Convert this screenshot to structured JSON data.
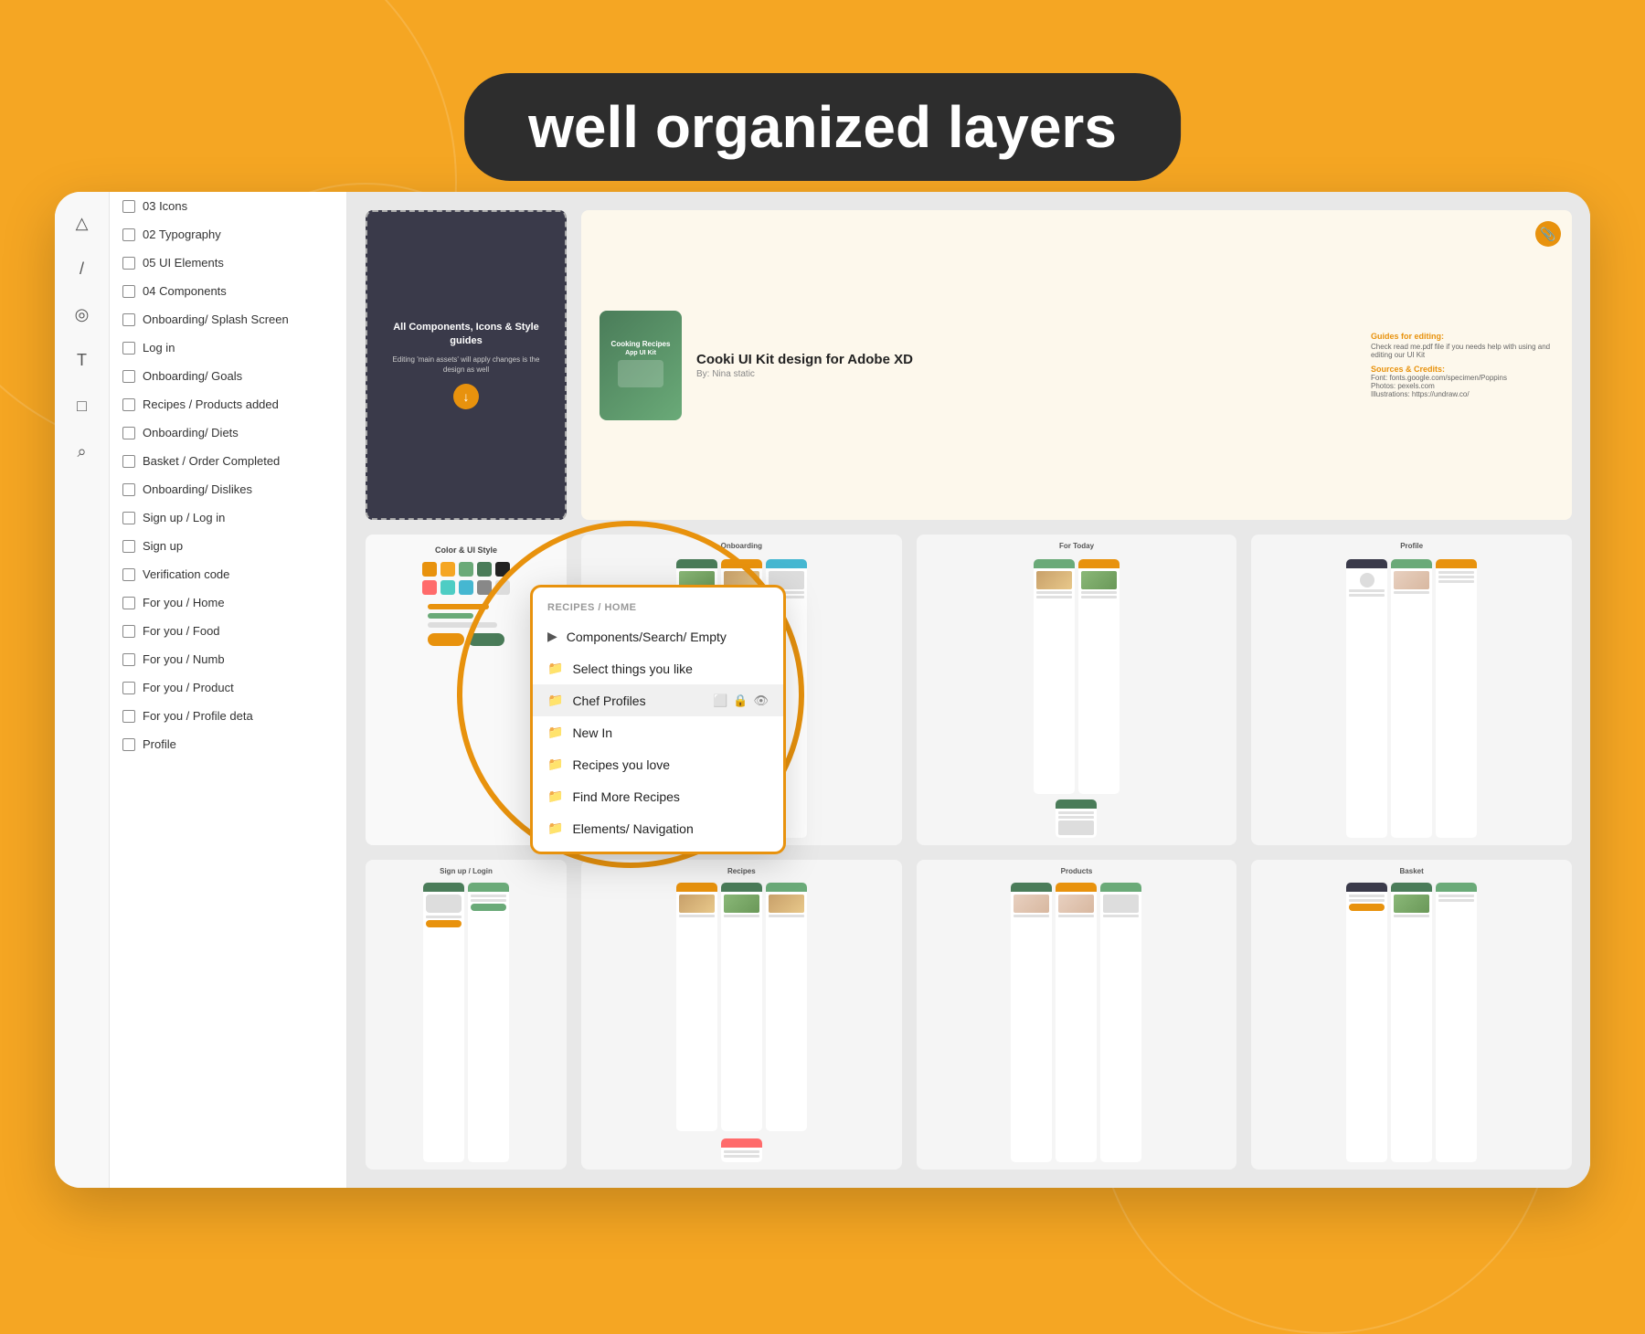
{
  "page": {
    "title": "well organized layers",
    "background_color": "#F5A623"
  },
  "header": {
    "badge_text": "well organized layers"
  },
  "toolbar": {
    "icons": [
      "△",
      "/",
      "◎",
      "T",
      "□",
      "⌕"
    ]
  },
  "layers_panel": {
    "items": [
      {
        "type": "layer",
        "label": "03 Icons"
      },
      {
        "type": "layer",
        "label": "02 Typography"
      },
      {
        "type": "layer",
        "label": "05 UI Elements"
      },
      {
        "type": "layer",
        "label": "04 Components"
      },
      {
        "type": "layer",
        "label": "Onboarding/ Splash Screen"
      },
      {
        "type": "layer",
        "label": "Log in"
      },
      {
        "type": "layer",
        "label": "Onboarding/ Goals"
      },
      {
        "type": "layer",
        "label": "Recipes / Products added"
      },
      {
        "type": "layer",
        "label": "Onboarding/ Diets"
      },
      {
        "type": "layer",
        "label": "Basket / Order Completed"
      },
      {
        "type": "layer",
        "label": "Onboarding/  Dislikes"
      },
      {
        "type": "layer",
        "label": "Sign up / Log in"
      },
      {
        "type": "layer",
        "label": "Sign up"
      },
      {
        "type": "layer",
        "label": "Verification code"
      },
      {
        "type": "layer",
        "label": "For you / Home"
      },
      {
        "type": "layer",
        "label": "For you / Food"
      },
      {
        "type": "layer",
        "label": "For you / Numb"
      },
      {
        "type": "layer",
        "label": "For you / Product"
      },
      {
        "type": "layer",
        "label": "For you / Profile deta"
      },
      {
        "type": "layer",
        "label": "Profile"
      }
    ]
  },
  "folder_popup": {
    "header": "RECIPES / HOME",
    "items": [
      {
        "label": "Components/Search/ Empty",
        "has_actions": false
      },
      {
        "label": "Select things you like",
        "has_actions": false
      },
      {
        "label": "Chef Profiles",
        "has_actions": true
      },
      {
        "label": "New In",
        "has_actions": false
      },
      {
        "label": "Recipes you love",
        "has_actions": false
      },
      {
        "label": "Find More Recipes",
        "has_actions": false
      },
      {
        "label": "Elements/ Navigation",
        "has_actions": false
      }
    ]
  },
  "canvas": {
    "intro_card": {
      "title": "All Components, Icons & Style guides",
      "subtitle": "Editing 'main assets' will apply changes is the design as well"
    },
    "kit_info": {
      "title": "Cooki UI Kit design for Adobe XD",
      "subtitle": "By: Nina static",
      "phone_label": "Cooking Recipes App UI Kit",
      "guide_title": "Guides for editing:",
      "guide_text": "Check read me.pdf file if you needs help with using and editing our UI Kit",
      "sources_title": "Sources & Credits:",
      "font_info": "Font: fonts.google.com/specimen/Poppins",
      "photos_info": "Photos: pexels.com",
      "illustrations_info": "Illustrations: https://undraw.co/"
    },
    "style_guide_colors": [
      "#E8920D",
      "#F5A623",
      "#6aaa78",
      "#4a7c59",
      "#222",
      "#555",
      "#888",
      "#ddd",
      "#3a3a4a",
      "#fdf8ec"
    ],
    "sections": {
      "onboarding": "Onboarding",
      "for_today": "For Today",
      "profile": "Profile",
      "sign_up_login": "Sign up / Login",
      "recipes": "Recipes",
      "products": "Products",
      "basket": "Basket"
    }
  }
}
